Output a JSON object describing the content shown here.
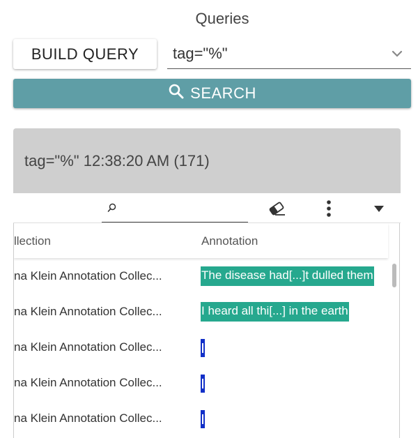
{
  "page": {
    "title": "Queries"
  },
  "query_bar": {
    "build_label": "BUILD QUERY",
    "selected_query": "tag=\"%\"",
    "dropdown_icon": "chevron-down-icon"
  },
  "search_button": {
    "label": "SEARCH",
    "icon": "search-icon"
  },
  "result": {
    "header": "tag=\"%\" 12:38:20 AM (171)",
    "toolbar": {
      "filter_value": "",
      "icons": [
        "search-icon",
        "eraser-icon",
        "more-vertical-icon",
        "caret-down-icon"
      ]
    },
    "columns": [
      "llection",
      "Annotation"
    ],
    "rows": [
      {
        "collection": "na Klein Annotation Collec...",
        "annotation": "The disease had[...]t dulled them",
        "kind": "text"
      },
      {
        "collection": "na Klein Annotation Collec...",
        "annotation": "I heard all thi[...] in the earth",
        "kind": "text"
      },
      {
        "collection": "na Klein Annotation Collec...",
        "annotation": "",
        "kind": "marker"
      },
      {
        "collection": "na Klein Annotation Collec...",
        "annotation": "",
        "kind": "marker"
      },
      {
        "collection": "na Klein Annotation Collec...",
        "annotation": "",
        "kind": "marker"
      }
    ]
  },
  "colors": {
    "search_button": "#5f9ea6",
    "header_bg": "#cfcfcf",
    "annotation_highlight": "#26a88e",
    "annotation_marker": "#1230c8"
  }
}
